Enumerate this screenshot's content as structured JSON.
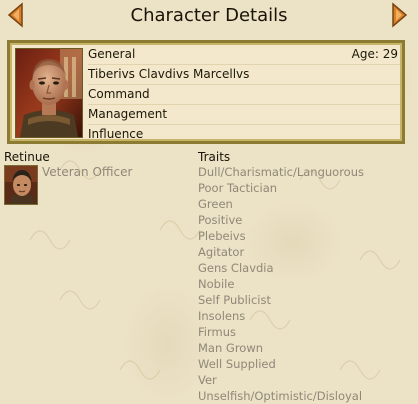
{
  "header": {
    "title": "Character Details"
  },
  "character": {
    "rank": "General",
    "name": "Tiberivs Clavdivs Marcellvs",
    "command": "Command",
    "management": "Management",
    "influence": "Influence",
    "age": "Age: 29"
  },
  "retinue": {
    "title": "Retinue",
    "items": [
      {
        "label": "Veteran Officer",
        "icon": "veteran-officer-icon"
      }
    ]
  },
  "traits": {
    "title": "Traits",
    "items": [
      "Dull/Charismatic/Languorous",
      "Poor Tactician",
      "Green",
      "Positive",
      "Plebeivs",
      "Agitator",
      "Gens Clavdia",
      "Nobile",
      "Self Publicist",
      "Insolens",
      "Firmus",
      "Man Grown",
      "Well Supplied",
      "Ver",
      "Unselfish/Optimistic/Disloyal"
    ]
  },
  "colors": {
    "background": "#ece2c6",
    "panel_border": "#8c7b32",
    "panel_fill": "#f3e8cb",
    "trait_text": "#8f8878",
    "arrow_orange": "#d9812a"
  },
  "icons": {
    "prev": "arrow-left-icon",
    "next": "arrow-right-icon",
    "portrait": "character-portrait"
  }
}
